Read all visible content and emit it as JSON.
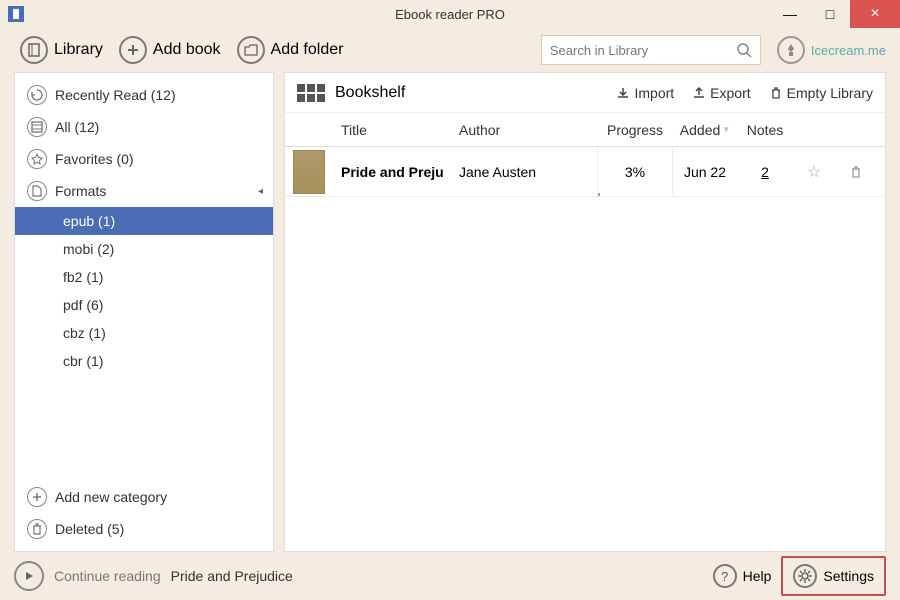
{
  "window": {
    "title": "Ebook reader PRO"
  },
  "toolbar": {
    "library": "Library",
    "add_book": "Add book",
    "add_folder": "Add folder"
  },
  "search": {
    "placeholder": "Search in Library"
  },
  "user": {
    "name": "Icecream.me"
  },
  "sidebar": {
    "items": [
      {
        "label": "Recently Read (12)"
      },
      {
        "label": "All (12)"
      },
      {
        "label": "Favorites (0)"
      },
      {
        "label": "Formats"
      }
    ],
    "formats": [
      {
        "label": "epub (1)",
        "selected": true
      },
      {
        "label": "mobi (2)"
      },
      {
        "label": "fb2 (1)"
      },
      {
        "label": "pdf (6)"
      },
      {
        "label": "cbz (1)"
      },
      {
        "label": "cbr (1)"
      }
    ],
    "footer": {
      "add_category": "Add new category",
      "deleted": "Deleted (5)"
    }
  },
  "content": {
    "view_label": "Bookshelf",
    "actions": {
      "import": "Import",
      "export": "Export",
      "empty": "Empty Library"
    },
    "columns": {
      "title": "Title",
      "author": "Author",
      "progress": "Progress",
      "added": "Added",
      "notes": "Notes"
    },
    "rows": [
      {
        "title": "Pride and Preju",
        "author": "Jane Austen",
        "progress": "3%",
        "added": "Jun 22",
        "notes": "2"
      }
    ]
  },
  "bottom": {
    "continue": "Continue reading",
    "current_book": "Pride and Prejudice",
    "help": "Help",
    "settings": "Settings"
  }
}
